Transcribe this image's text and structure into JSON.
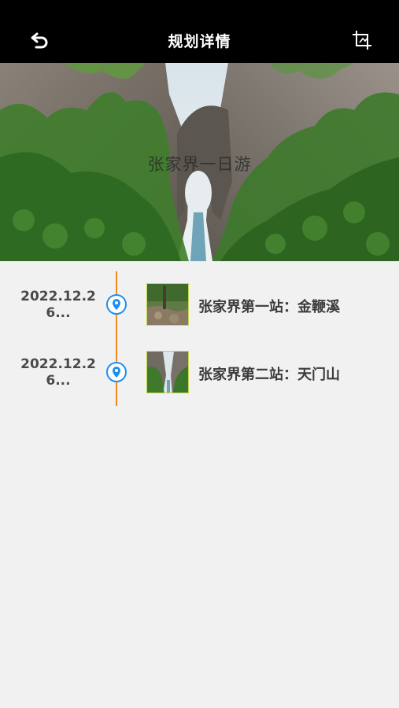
{
  "header": {
    "title": "规划详情",
    "back_icon": "undo-arrow-icon",
    "crop_icon": "crop-icon"
  },
  "hero": {
    "title": "张家界一日游"
  },
  "timeline": {
    "line_color": "#f08a1c",
    "pin_color": "#1e8ff0",
    "items": [
      {
        "date_line1": "2022.12.2",
        "date_line2": "6...",
        "name": "张家界第一站：金鞭溪"
      },
      {
        "date_line1": "2022.12.2",
        "date_line2": "6...",
        "name": "张家界第二站：天门山"
      }
    ]
  }
}
